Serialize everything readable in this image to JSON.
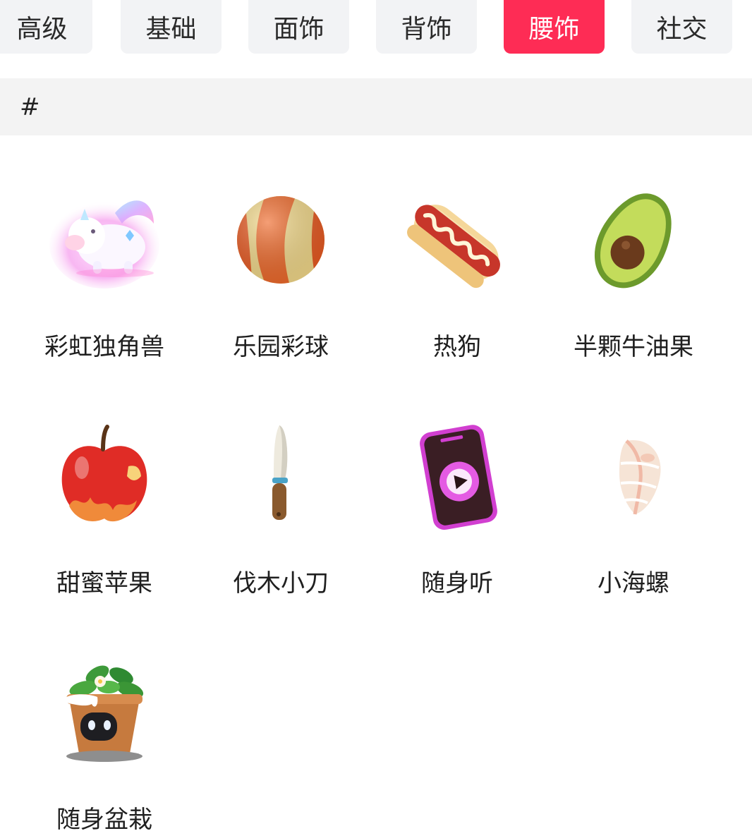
{
  "tabs": [
    {
      "label": "高级",
      "active": false
    },
    {
      "label": "基础",
      "active": false
    },
    {
      "label": "面饰",
      "active": false
    },
    {
      "label": "背饰",
      "active": false
    },
    {
      "label": "腰饰",
      "active": true
    },
    {
      "label": "社交",
      "active": false
    }
  ],
  "section": {
    "title": "#"
  },
  "items": [
    {
      "label": "彩虹独角兽",
      "icon": "unicorn-icon"
    },
    {
      "label": "乐园彩球",
      "icon": "beach-ball-icon"
    },
    {
      "label": "热狗",
      "icon": "hotdog-icon"
    },
    {
      "label": "半颗牛油果",
      "icon": "avocado-icon"
    },
    {
      "label": "甜蜜苹果",
      "icon": "apple-icon"
    },
    {
      "label": "伐木小刀",
      "icon": "knife-icon"
    },
    {
      "label": "随身听",
      "icon": "music-player-icon"
    },
    {
      "label": "小海螺",
      "icon": "seashell-icon"
    },
    {
      "label": "随身盆栽",
      "icon": "potted-plant-icon"
    }
  ],
  "colors": {
    "accent": "#fe2c55",
    "tab_bg": "#f2f3f5",
    "header_bg": "#f3f3f3"
  }
}
